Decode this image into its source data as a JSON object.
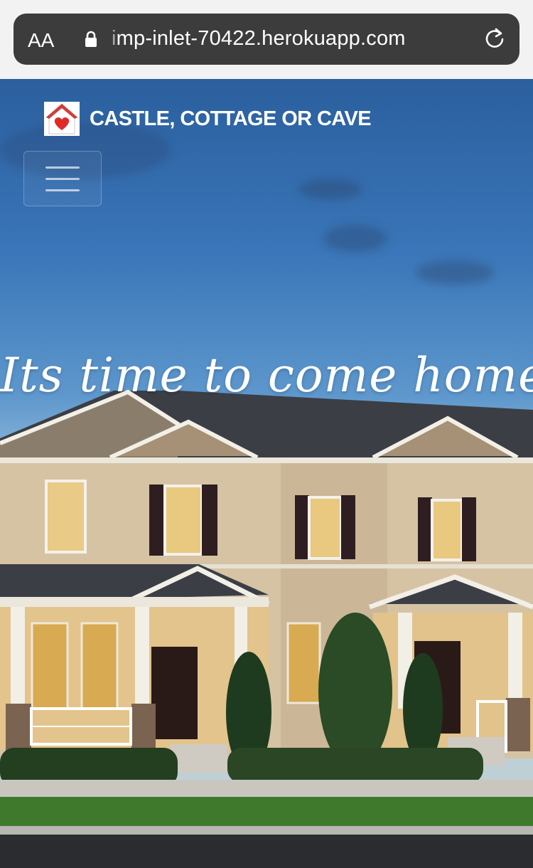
{
  "browser": {
    "text_size_label": "AA",
    "url_faded": "i",
    "url": "mp-inlet-70422.herokuapp.com"
  },
  "site": {
    "brand_name": "CASTLE, COTTAGE OR CAVE",
    "hero_tagline": "Its time to come home"
  },
  "colors": {
    "address_bar": "#3c3c3c",
    "sky_top": "#2b5f9e",
    "logo_heart": "#e02a2a"
  }
}
